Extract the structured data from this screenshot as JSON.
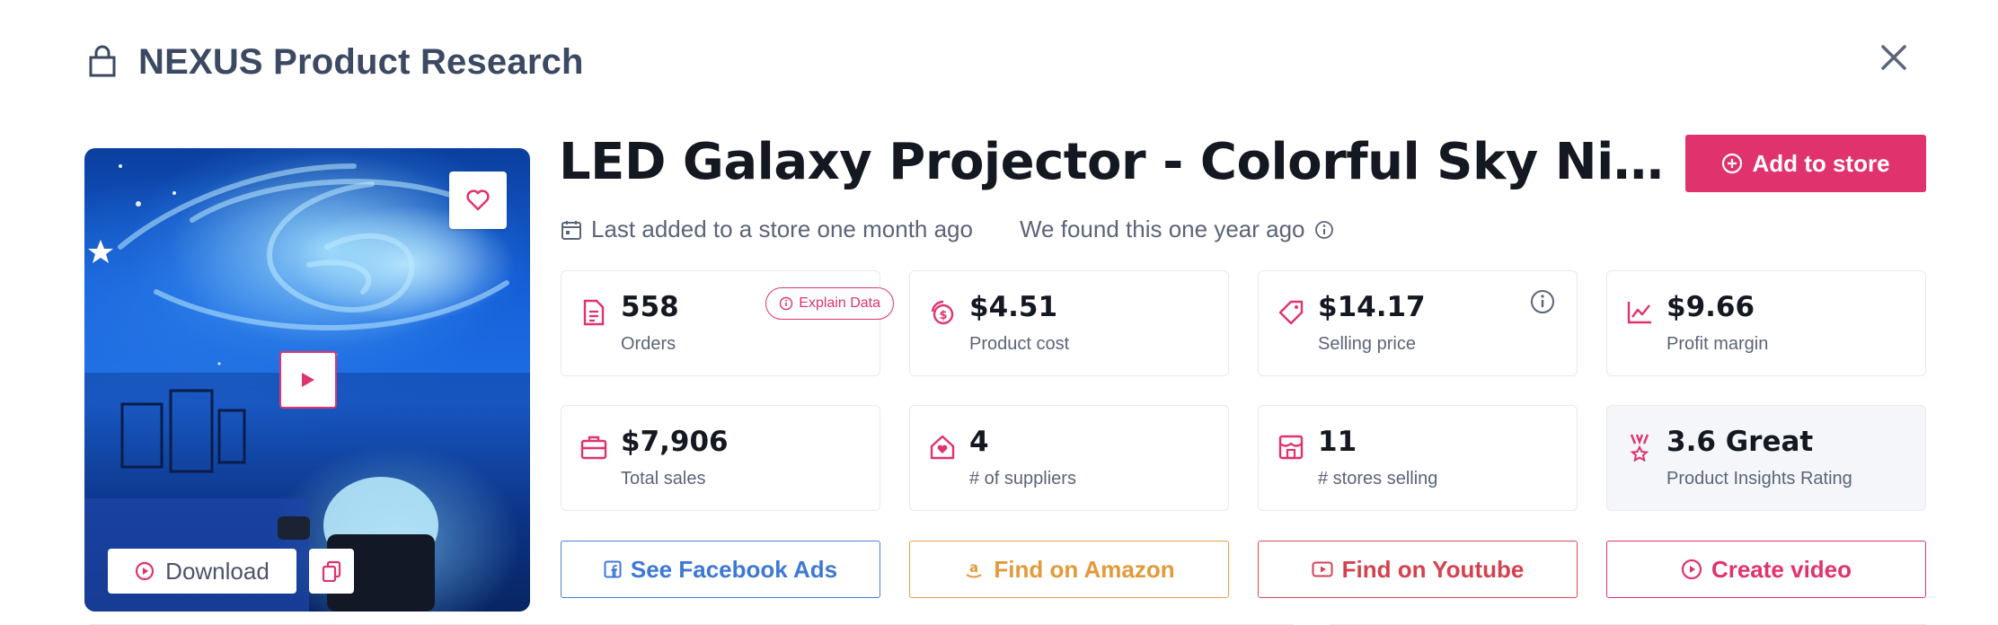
{
  "header": {
    "title": "NEXUS Product Research",
    "icon": "shopping-bag-icon"
  },
  "product": {
    "title": "LED Galaxy Projector - Colorful Sky Ni…",
    "last_added": "Last added to a store one month ago",
    "found": "We found this one year ago"
  },
  "media": {
    "download_label": "Download"
  },
  "actions_top": {
    "add_to_store": "Add to store"
  },
  "stats": [
    {
      "value": "558",
      "label": "Orders",
      "icon": "document-icon"
    },
    {
      "value": "$4.51",
      "label": "Product cost",
      "icon": "coins-icon"
    },
    {
      "value": "$14.17",
      "label": "Selling price",
      "icon": "price-tag-icon"
    },
    {
      "value": "$9.66",
      "label": "Profit margin",
      "icon": "chart-line-icon"
    },
    {
      "value": "$7,906",
      "label": "Total sales",
      "icon": "briefcase-icon"
    },
    {
      "value": "4",
      "label": "# of suppliers",
      "icon": "home-heart-icon"
    },
    {
      "value": "11",
      "label": "# stores selling",
      "icon": "store-icon"
    },
    {
      "value": "3.6 Great",
      "label": "Product Insights Rating",
      "icon": "award-icon"
    }
  ],
  "explain_label": "Explain Data",
  "buttons": {
    "facebook": "See Facebook Ads",
    "amazon": "Find on Amazon",
    "youtube": "Find on Youtube",
    "video": "Create video"
  },
  "colors": {
    "accent": "#e0336e",
    "facebook": "#3e78d6",
    "amazon": "#e39a3a",
    "youtube": "#d3424f",
    "header_text": "#3b4962"
  }
}
